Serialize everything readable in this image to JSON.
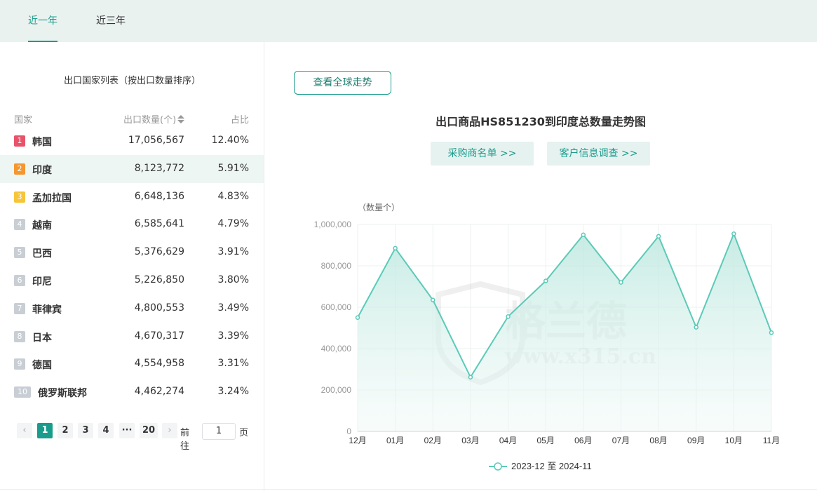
{
  "tabs": [
    {
      "label": "近一年",
      "active": true
    },
    {
      "label": "近三年",
      "active": false
    }
  ],
  "country_list": {
    "title": "出口国家列表（按出口数量排序）",
    "headers": {
      "country": "国家",
      "quantity": "出口数量(个)",
      "share": "占比"
    },
    "rows": [
      {
        "rank": "1",
        "country": "韩国",
        "quantity": "17,056,567",
        "share": "12.40%"
      },
      {
        "rank": "2",
        "country": "印度",
        "quantity": "8,123,772",
        "share": "5.91%"
      },
      {
        "rank": "3",
        "country": "孟加拉国",
        "quantity": "6,648,136",
        "share": "4.83%"
      },
      {
        "rank": "4",
        "country": "越南",
        "quantity": "6,585,641",
        "share": "4.79%"
      },
      {
        "rank": "5",
        "country": "巴西",
        "quantity": "5,376,629",
        "share": "3.91%"
      },
      {
        "rank": "6",
        "country": "印尼",
        "quantity": "5,226,850",
        "share": "3.80%"
      },
      {
        "rank": "7",
        "country": "菲律宾",
        "quantity": "4,800,553",
        "share": "3.49%"
      },
      {
        "rank": "8",
        "country": "日本",
        "quantity": "4,670,317",
        "share": "3.39%"
      },
      {
        "rank": "9",
        "country": "德国",
        "quantity": "4,554,958",
        "share": "3.31%"
      },
      {
        "rank": "10",
        "country": "俄罗斯联邦",
        "quantity": "4,462,274",
        "share": "3.24%"
      }
    ]
  },
  "pagination": {
    "prev": "‹",
    "pages": [
      "1",
      "2",
      "3",
      "4",
      "···",
      "20"
    ],
    "current": "1",
    "next": "›",
    "goto_label": "前往",
    "goto_value": "1",
    "page_unit": "页"
  },
  "buttons": {
    "global_trend": "查看全球走势",
    "buyers": "采购商名单 >>",
    "customer_survey": "客户信息调查 >>"
  },
  "chart_data": {
    "type": "area",
    "title": "出口商品HS851230到印度总数量走势图",
    "ylabel": "（数量个）",
    "x": [
      "12月",
      "01月",
      "02月",
      "03月",
      "04月",
      "05月",
      "06月",
      "07月",
      "08月",
      "09月",
      "10月",
      "11月"
    ],
    "series": [
      {
        "name": "2023-12 至 2024-11",
        "values": [
          550000,
          885000,
          635000,
          262000,
          555000,
          727000,
          950000,
          720000,
          943000,
          503000,
          955000,
          477000
        ]
      }
    ],
    "yticks": [
      "0",
      "200,000",
      "400,000",
      "600,000",
      "800,000",
      "1,000,000"
    ],
    "ylim": [
      0,
      1000000
    ],
    "grid": true,
    "legend": "bottom",
    "colors": {
      "line": "#5ccab8",
      "fill": "#cdeee8"
    },
    "watermark": "格兰德 www.x315.cn"
  }
}
